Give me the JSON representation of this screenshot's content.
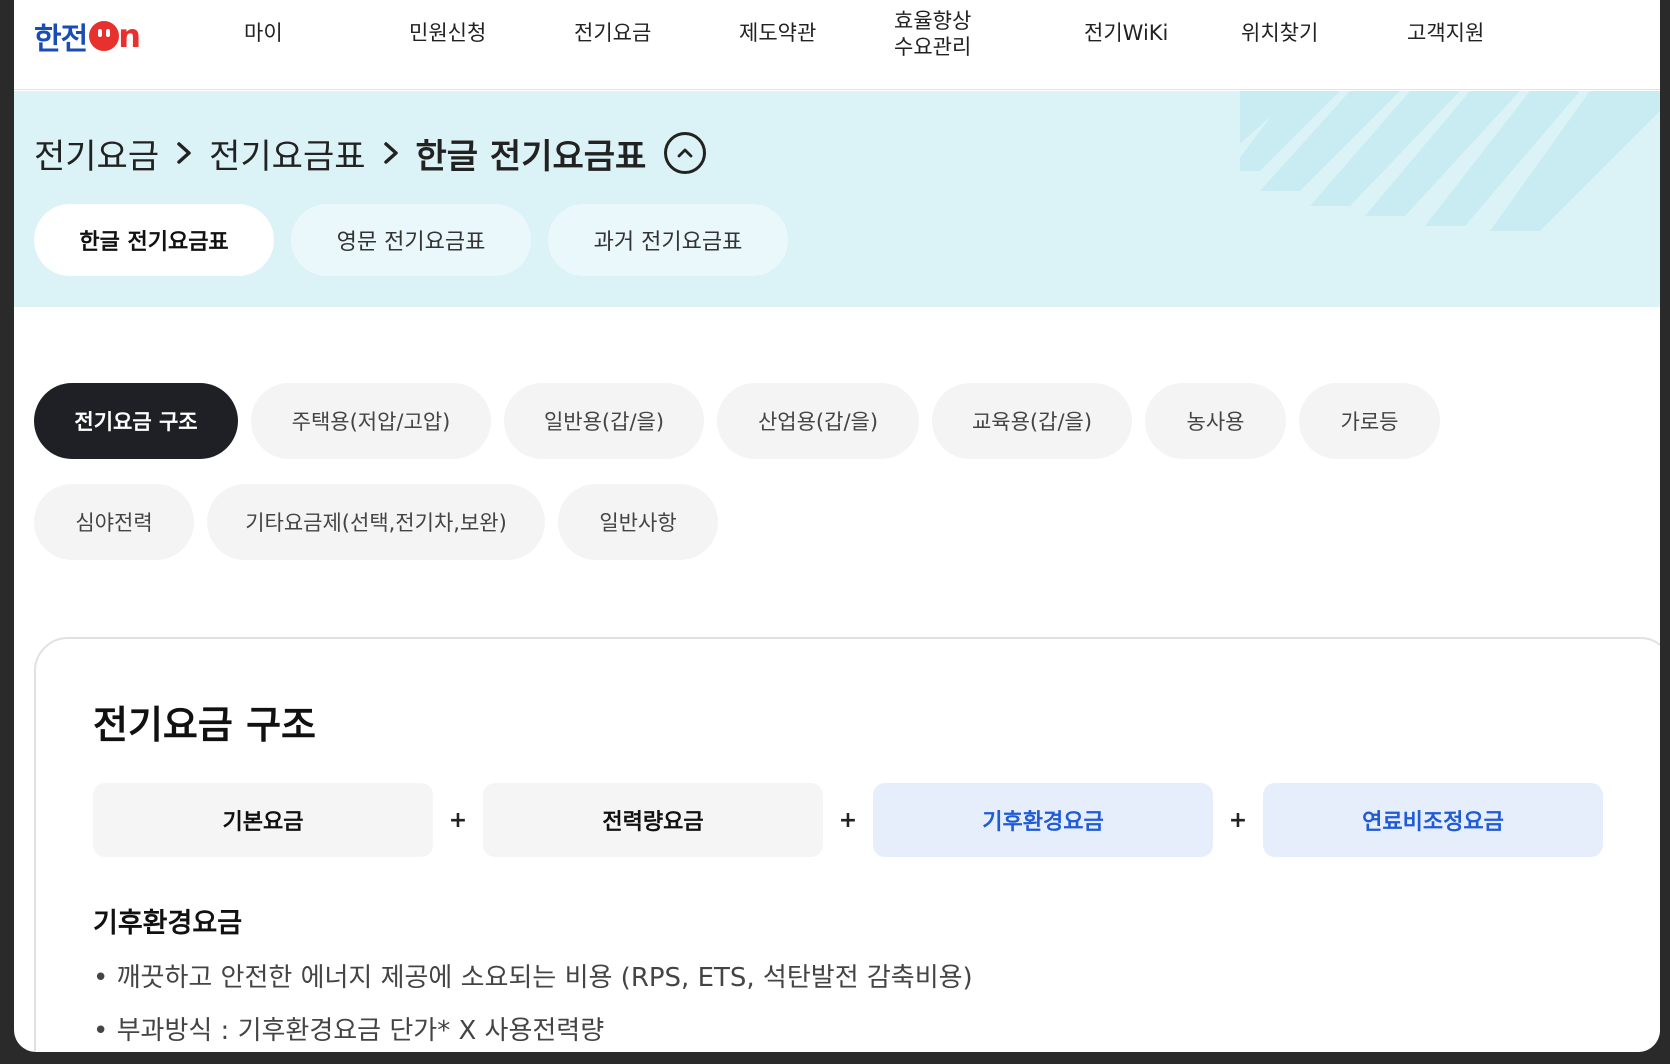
{
  "nav": {
    "logo_text": "한전",
    "logo_on": "ON",
    "items": [
      {
        "label": "마이"
      },
      {
        "label": "민원신청"
      },
      {
        "label": "전기요금"
      },
      {
        "label": "제도약관"
      },
      {
        "label": "효율향상\n수요관리"
      },
      {
        "label": "전기WiKi"
      },
      {
        "label": "위치찾기"
      },
      {
        "label": "고객지원"
      }
    ]
  },
  "breadcrumb": {
    "items": [
      "전기요금",
      "전기요금표",
      "한글 전기요금표"
    ]
  },
  "subtabs": [
    {
      "label": "한글 전기요금표",
      "active": true
    },
    {
      "label": "영문 전기요금표",
      "active": false
    },
    {
      "label": "과거 전기요금표",
      "active": false
    }
  ],
  "chips": {
    "row1": [
      "전기요금 구조",
      "주택용(저압/고압)",
      "일반용(갑/을)",
      "산업용(갑/을)",
      "교육용(갑/을)",
      "농사용",
      "가로등"
    ],
    "row2": [
      "심야전력",
      "기타요금제(선택,전기차,보완)",
      "일반사항"
    ],
    "active": "전기요금 구조"
  },
  "card": {
    "title": "전기요금 구조",
    "formula": [
      "기본요금",
      "전력량요금",
      "기후환경요금",
      "연료비조정요금"
    ],
    "operator": "+",
    "section_title": "기후환경요금",
    "bullets": [
      "• 깨끗하고 안전한 에너지 제공에 소요되는 비용 (RPS, ETS, 석탄발전 감축비용)",
      "• 부과방식 : 기후환경요금 단가* X 사용전력량"
    ]
  },
  "colors": {
    "brand_blue": "#1a4db3",
    "brand_red": "#e8312f",
    "hero_bg": "#dbf3f7",
    "active_chip": "#1f2025",
    "highlight_blue": "#1f5bd6"
  }
}
